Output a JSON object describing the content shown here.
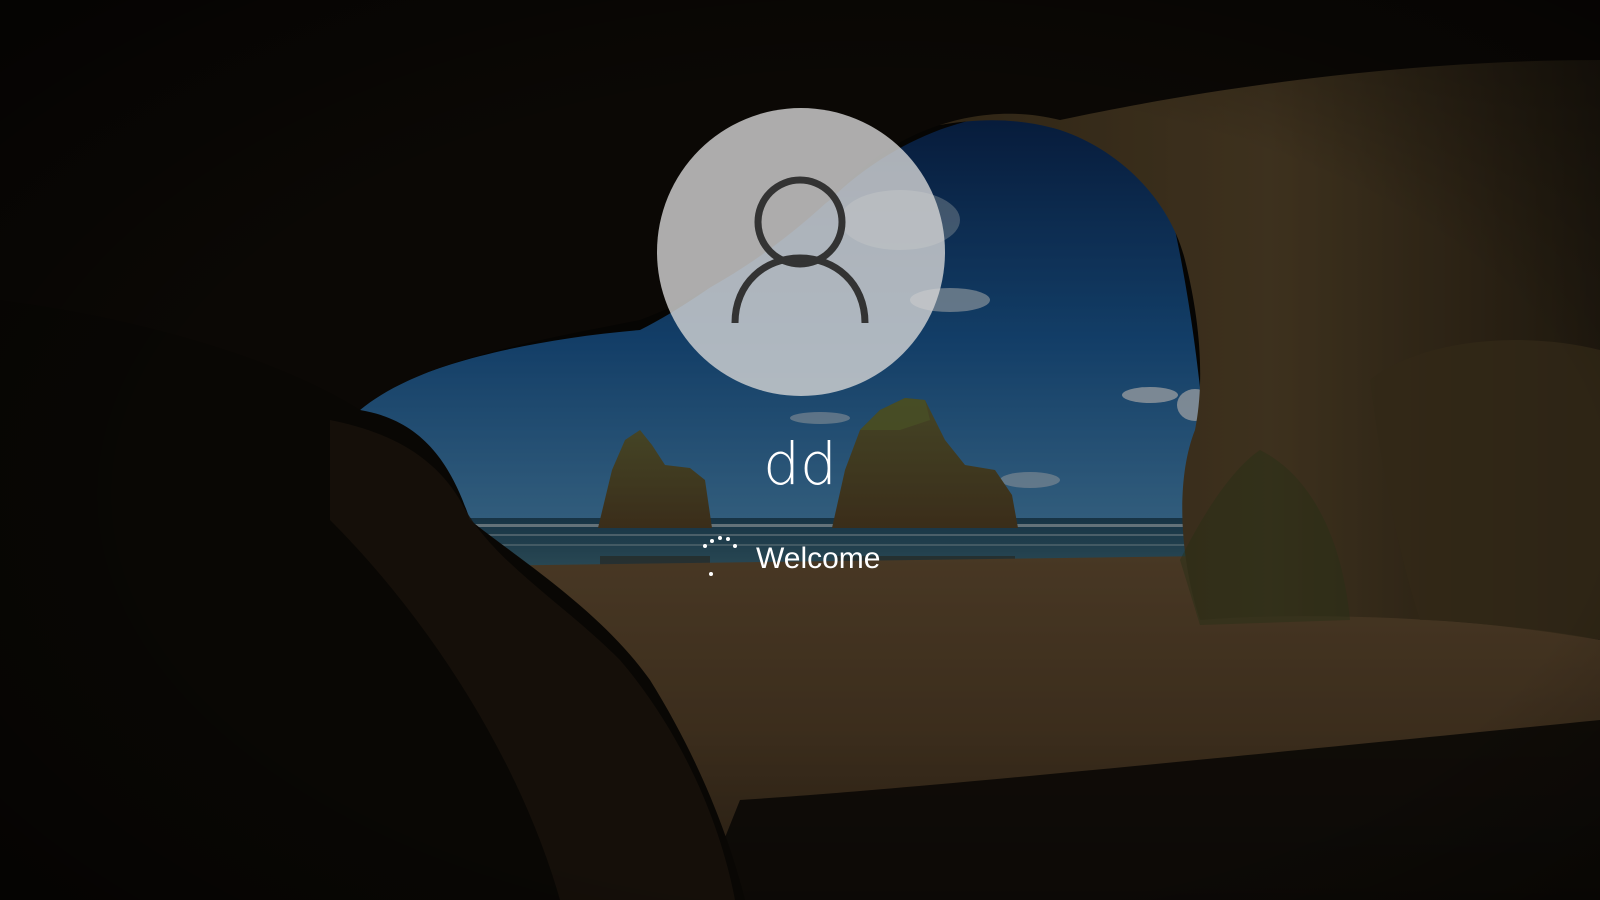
{
  "lock_screen": {
    "user": {
      "name": "dd",
      "avatar_icon": "person-outline-icon"
    },
    "status": {
      "text": "Welcome",
      "spinner_icon": "loading-dots-icon"
    }
  },
  "colors": {
    "text": "#ffffff",
    "avatar_background": "#d6d6d6",
    "avatar_glyph": "#333333"
  }
}
